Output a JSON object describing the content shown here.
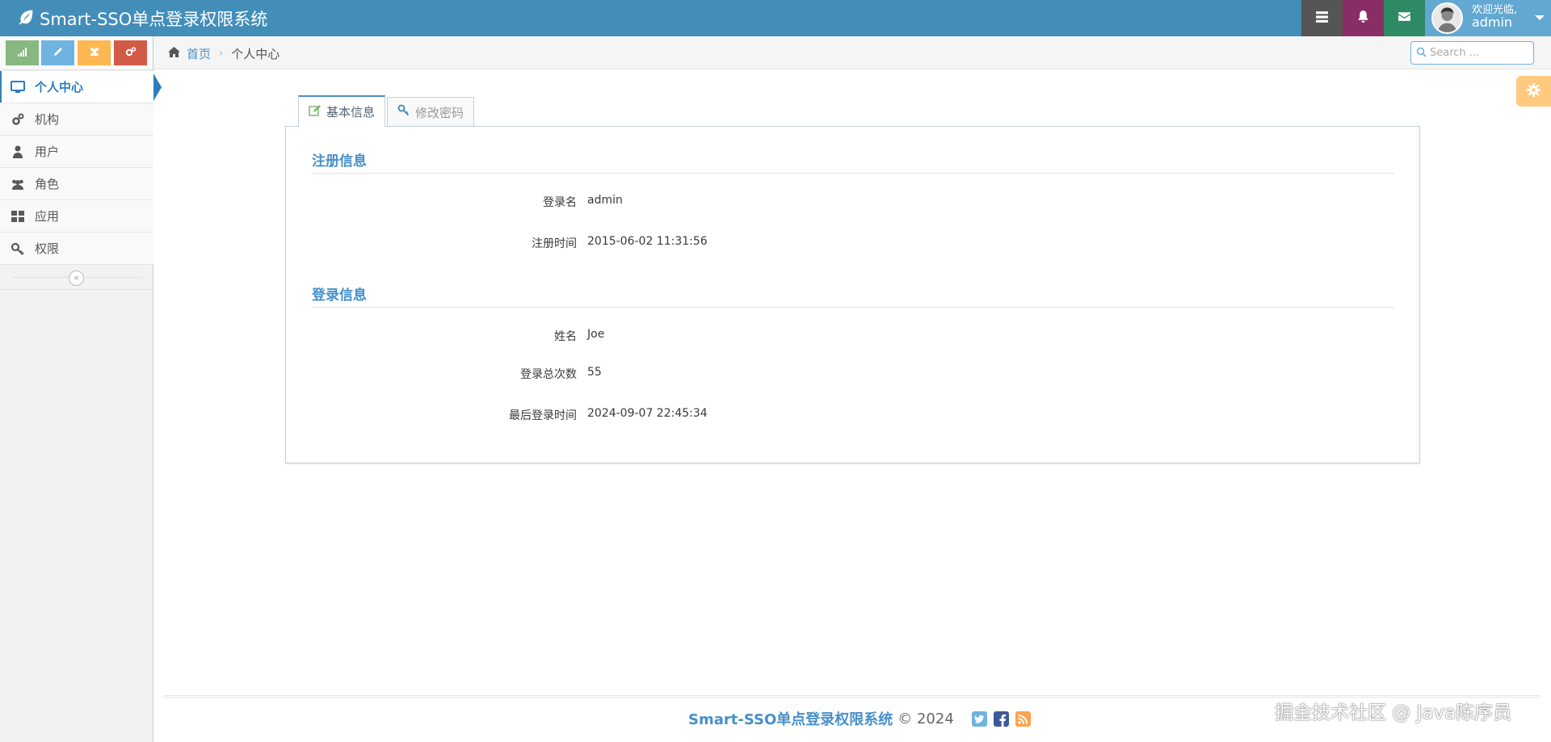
{
  "app": {
    "title": "Smart-SSO单点登录权限系统"
  },
  "user": {
    "welcome": "欢迎光临,",
    "name": "admin"
  },
  "sidebar": {
    "items": [
      {
        "label": "个人中心",
        "icon": "desktop-icon",
        "active": true
      },
      {
        "label": "机构",
        "icon": "gears-icon"
      },
      {
        "label": "用户",
        "icon": "user-icon"
      },
      {
        "label": "角色",
        "icon": "users-icon"
      },
      {
        "label": "应用",
        "icon": "grid-icon"
      },
      {
        "label": "权限",
        "icon": "key-icon"
      }
    ],
    "collapse_glyph": "«"
  },
  "breadcrumb": {
    "home": "首页",
    "separator": "›",
    "current": "个人中心"
  },
  "search": {
    "placeholder": "Search ..."
  },
  "tabs": [
    {
      "label": "基本信息",
      "active": true
    },
    {
      "label": "修改密码",
      "active": false
    }
  ],
  "registration": {
    "title": "注册信息",
    "fields": [
      {
        "label": "登录名",
        "value": "admin"
      },
      {
        "label": "注册时间",
        "value": "2015-06-02 11:31:56"
      }
    ]
  },
  "login": {
    "title": "登录信息",
    "fields": [
      {
        "label": "姓名",
        "value": "Joe"
      },
      {
        "label": "登录总次数",
        "value": "55"
      },
      {
        "label": "最后登录时间",
        "value": "2024-09-07 22:45:34"
      }
    ]
  },
  "footer": {
    "brand": "Smart-SSO单点登录权限系统",
    "copyright": "© 2024"
  },
  "watermark": "掘金技术社区 @ Java陈序员",
  "colors": {
    "navbar": "#438eb9",
    "accent": "#478fca"
  }
}
